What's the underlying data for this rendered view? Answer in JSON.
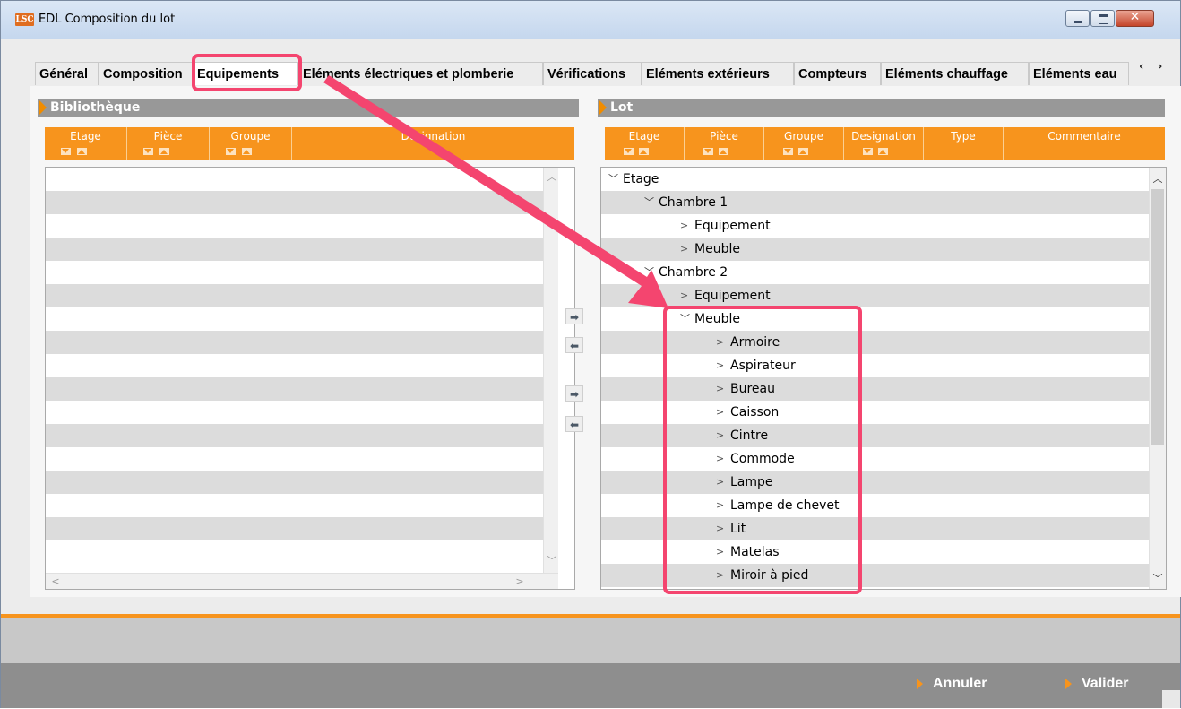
{
  "window": {
    "logo": "LSC",
    "title": "EDL Composition du lot",
    "close_glyph": "✕"
  },
  "tabs": [
    {
      "label": "Général"
    },
    {
      "label": "Composition"
    },
    {
      "label": "Equipements"
    },
    {
      "label": "Eléments électriques et plomberie"
    },
    {
      "label": "Vérifications"
    },
    {
      "label": "Eléments extérieurs"
    },
    {
      "label": "Compteurs"
    },
    {
      "label": "Eléments chauffage"
    },
    {
      "label": "Eléments eau"
    }
  ],
  "tab_scroll": {
    "left": "‹",
    "right": "›"
  },
  "library": {
    "title": "Bibliothèque",
    "columns": [
      "Etage",
      "Pièce",
      "Groupe",
      "Designation"
    ]
  },
  "lot": {
    "title": "Lot",
    "columns": [
      "Etage",
      "Pièce",
      "Groupe",
      "Designation",
      "Type",
      "Commentaire"
    ],
    "tree": [
      {
        "label": "Etage",
        "expanded": true
      },
      {
        "label": "Chambre 1",
        "expanded": true
      },
      {
        "label": "Equipement",
        "expanded": false
      },
      {
        "label": "Meuble",
        "expanded": false
      },
      {
        "label": "Chambre 2",
        "expanded": true
      },
      {
        "label": "Equipement",
        "expanded": false
      },
      {
        "label": "Meuble",
        "expanded": true
      },
      {
        "label": "Armoire",
        "expanded": false
      },
      {
        "label": "Aspirateur",
        "expanded": false
      },
      {
        "label": "Bureau",
        "expanded": false
      },
      {
        "label": "Caisson",
        "expanded": false
      },
      {
        "label": "Cintre",
        "expanded": false
      },
      {
        "label": "Commode",
        "expanded": false
      },
      {
        "label": "Lampe",
        "expanded": false
      },
      {
        "label": "Lampe de chevet",
        "expanded": false
      },
      {
        "label": "Lit",
        "expanded": false
      },
      {
        "label": "Matelas",
        "expanded": false
      },
      {
        "label": "Miroir à pied",
        "expanded": false
      }
    ]
  },
  "footer": {
    "cancel": "Annuler",
    "ok": "Valider"
  },
  "colors": {
    "accent": "#f7941d",
    "highlight": "#f4456f",
    "row_alt": "#dcdcdc",
    "panel_head": "#989898"
  }
}
